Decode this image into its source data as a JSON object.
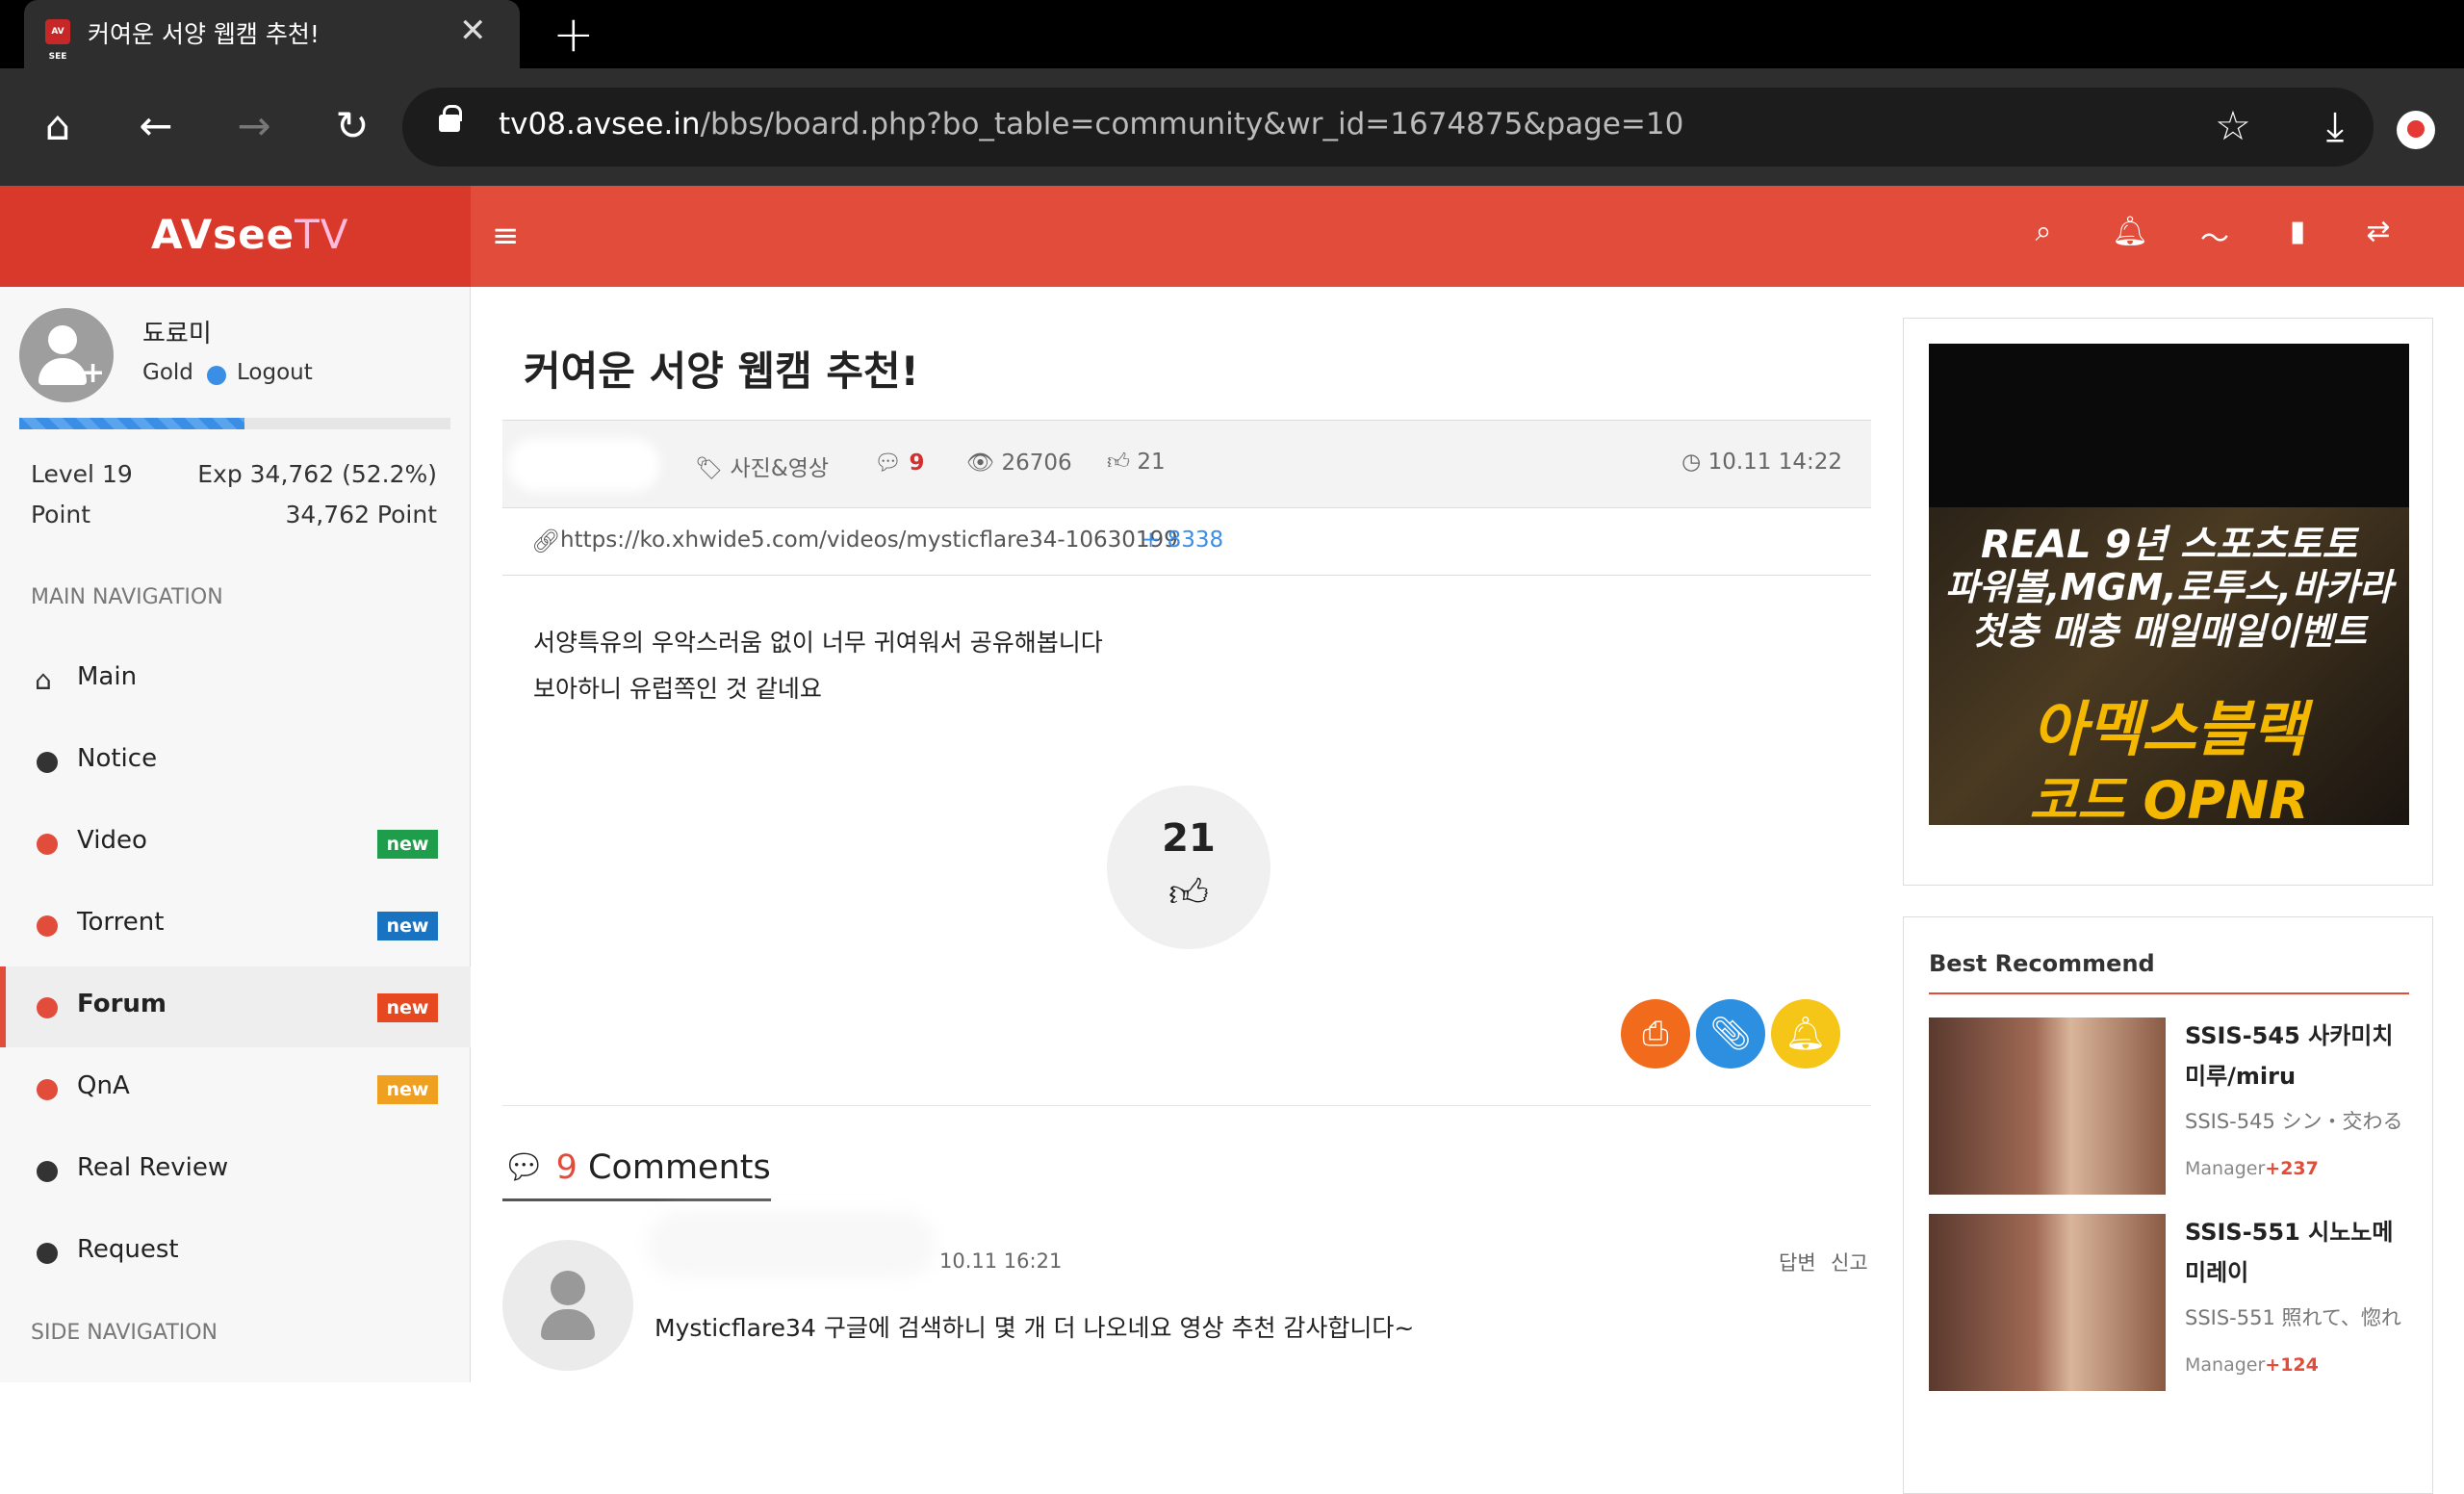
{
  "browser": {
    "tab_title": "커여운 서양 웹캠 추천!",
    "favicon_text": "AV SEE",
    "url_host": "tv08.avsee.in",
    "url_path": "/bbs/board.php?bo_table=community&wr_id=1674875&page=10"
  },
  "site": {
    "logo_bold": "AVsee",
    "logo_light": "TV"
  },
  "user": {
    "name": "됴료미",
    "grade": "Gold",
    "logout": "Logout",
    "xp_fraction": 0.522,
    "level_label": "Level 19",
    "exp_label": "Exp 34,762 (52.2%)",
    "point_label": "Point",
    "point_value": "34,762 Point"
  },
  "nav": {
    "main_heading": "MAIN NAVIGATION",
    "side_heading": "SIDE NAVIGATION",
    "items": [
      {
        "label": "Main",
        "dot": "#333",
        "badge": ""
      },
      {
        "label": "Notice",
        "dot": "#333",
        "badge": ""
      },
      {
        "label": "Video",
        "dot": "#e24c3a",
        "badge": "new",
        "badge_color": "#1e9e4a"
      },
      {
        "label": "Torrent",
        "dot": "#e24c3a",
        "badge": "new",
        "badge_color": "#1a73c0"
      },
      {
        "label": "Forum",
        "dot": "#e24c3a",
        "badge": "new",
        "badge_color": "#e8481f"
      },
      {
        "label": "QnA",
        "dot": "#e24c3a",
        "badge": "new",
        "badge_color": "#f0a020"
      },
      {
        "label": "Real Review",
        "dot": "#333",
        "badge": ""
      },
      {
        "label": "Request",
        "dot": "#333",
        "badge": ""
      }
    ]
  },
  "post": {
    "title": "커여운 서양 웹캠 추천!",
    "category": "사진&영상",
    "comments": "9",
    "views": "26706",
    "likes": "21",
    "datetime": "10.11 14:22",
    "link": "https://ko.xhwide5.com/videos/mysticflare34-10630199",
    "link_count": "+ 8338",
    "body": [
      "서양특유의 우악스러움 없이 너무 귀여워서 공유해봅니다",
      "보아하니 유럽쪽인 것 같네요"
    ],
    "like_count": "21"
  },
  "comments": {
    "count": "9",
    "label": "Comments",
    "items": [
      {
        "date": "10.11 16:21",
        "reply": "답변",
        "report": "신고",
        "text": "Mysticflare34 구글에 검색하니 몇 개 더 나오네요 영상 추천 감사합니다~"
      }
    ]
  },
  "ad": {
    "line1": "REAL 9년 스포츠토토",
    "line2": "파워볼,MGM,로투스,바카라",
    "line3": "첫충 매충 매일매일이벤트",
    "line4": "아멕스블랙",
    "line5": "코드 OPNR"
  },
  "recommend": {
    "title": "Best Recommend",
    "items": [
      {
        "title": "SSIS-545 사카미치 미루/miru",
        "sub": "SSIS-545 シン・交わる",
        "manager": "Manager",
        "points": "+237"
      },
      {
        "title": "SSIS-551 시노노메 미레이",
        "sub": "SSIS-551 照れて、惚れ",
        "manager": "Manager",
        "points": "+124"
      }
    ]
  }
}
